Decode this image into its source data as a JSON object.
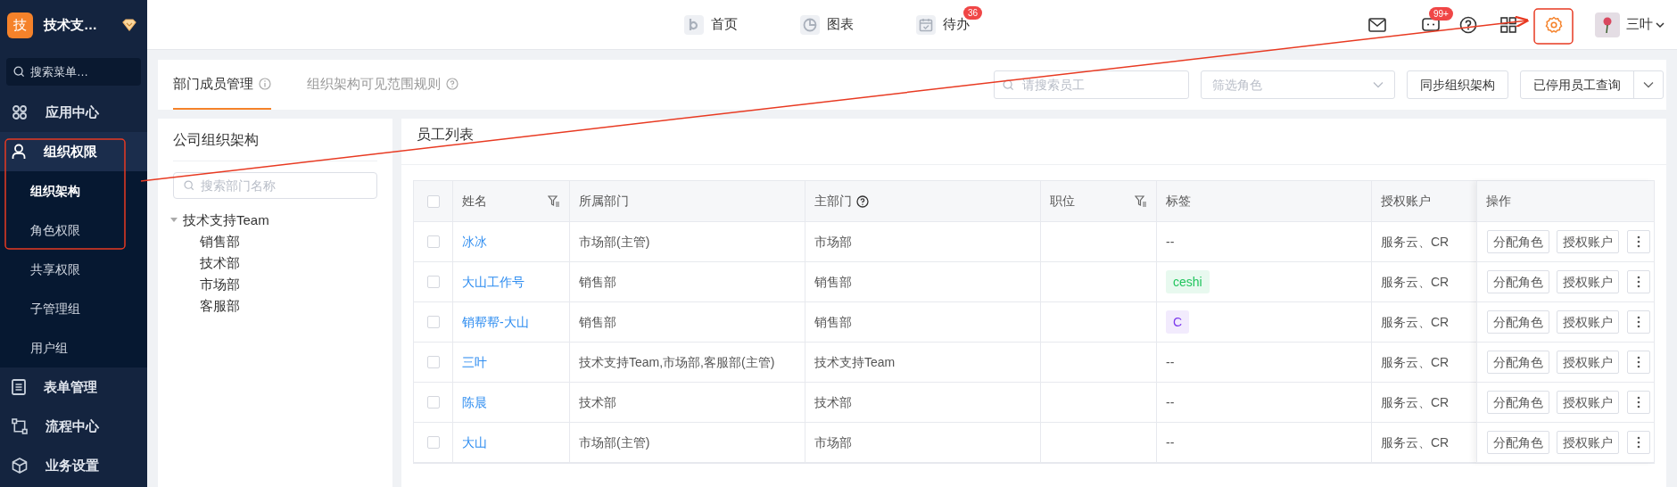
{
  "sidebar": {
    "logo": "技",
    "org_name": "技术支…",
    "search": {
      "placeholder": "搜索菜单…"
    },
    "items": [
      {
        "label": "应用中心",
        "expanded": false
      },
      {
        "label": "组织权限",
        "expanded": true,
        "children": [
          {
            "label": "组织架构",
            "selected": true
          },
          {
            "label": "角色权限",
            "selected": false
          },
          {
            "label": "共享权限",
            "selected": false
          },
          {
            "label": "子管理组",
            "selected": false
          },
          {
            "label": "用户组",
            "selected": false
          }
        ]
      },
      {
        "label": "表单管理",
        "expanded": false
      },
      {
        "label": "流程中心",
        "expanded": false
      },
      {
        "label": "业务设置",
        "expanded": false
      }
    ]
  },
  "top_nav": [
    {
      "label": "首页"
    },
    {
      "label": "图表"
    },
    {
      "label": "待办",
      "badge": "36"
    }
  ],
  "top_actions": {
    "message_badge": "99+",
    "user": "三叶"
  },
  "tabs": [
    {
      "label": "部门成员管理",
      "selected": true
    },
    {
      "label": "组织架构可见范围规则",
      "selected": false
    }
  ],
  "toolbar": {
    "search": {
      "placeholder": "请搜索员工"
    },
    "role_filter": {
      "placeholder": "筛选角色"
    },
    "sync_button": "同步组织架构",
    "disabled_query_button": "已停用员工查询"
  },
  "org_panel": {
    "title": "公司组织架构",
    "search": {
      "placeholder": "搜索部门名称"
    },
    "tree": [
      {
        "label": "技术支持Team",
        "expanded": true,
        "children": [
          {
            "label": "销售部"
          },
          {
            "label": "技术部"
          },
          {
            "label": "市场部"
          },
          {
            "label": "客服部"
          }
        ]
      }
    ]
  },
  "employee_panel": {
    "title": "员工列表",
    "table": {
      "select_all_checked": false,
      "columns": [
        {
          "label": "姓名",
          "filter": true,
          "help": false
        },
        {
          "label": "所属部门",
          "filter": false,
          "help": false
        },
        {
          "label": "主部门",
          "filter": false,
          "help": true
        },
        {
          "label": "职位",
          "filter": true,
          "help": false
        },
        {
          "label": "标签",
          "filter": false,
          "help": false
        },
        {
          "label": "授权账户",
          "filter": false,
          "help": false
        },
        {
          "label": "操作",
          "filter": false,
          "help": false
        }
      ],
      "rows": [
        {
          "checked": false,
          "name": "冰冰",
          "department": "市场部(主管)",
          "main_department": "市场部",
          "tag": {
            "kind": "empty",
            "text": "--"
          },
          "accounts": "服务云、CR",
          "actions": [
            "分配角色",
            "授权账户"
          ]
        },
        {
          "checked": false,
          "name": "大山工作号",
          "department": "销售部",
          "main_department": "销售部",
          "tag": {
            "kind": "badge",
            "text": "ceshi",
            "color": "#22c55e"
          },
          "accounts": "服务云、CR",
          "actions": [
            "分配角色",
            "授权账户"
          ]
        },
        {
          "checked": false,
          "name": "销帮帮-大山",
          "department": "销售部",
          "main_department": "销售部",
          "tag": {
            "kind": "badge",
            "text": "C",
            "color": "#7c3aed"
          },
          "accounts": "服务云、CR",
          "actions": [
            "分配角色",
            "授权账户"
          ]
        },
        {
          "checked": false,
          "name": "三叶",
          "department": "技术支持Team,市场部,客服部(主管)",
          "main_department": "技术支持Team",
          "tag": {
            "kind": "empty",
            "text": "--"
          },
          "accounts": "服务云、CR",
          "actions": [
            "分配角色",
            "授权账户"
          ]
        },
        {
          "checked": false,
          "name": "陈晨",
          "department": "技术部",
          "main_department": "技术部",
          "tag": {
            "kind": "empty",
            "text": "--"
          },
          "accounts": "服务云、CR",
          "actions": [
            "分配角色",
            "授权账户"
          ]
        },
        {
          "checked": false,
          "name": "大山",
          "department": "市场部(主管)",
          "main_department": "市场部",
          "tag": {
            "kind": "empty",
            "text": "--"
          },
          "accounts": "服务云、CR",
          "actions": [
            "分配角色",
            "授权账户"
          ]
        }
      ]
    }
  }
}
